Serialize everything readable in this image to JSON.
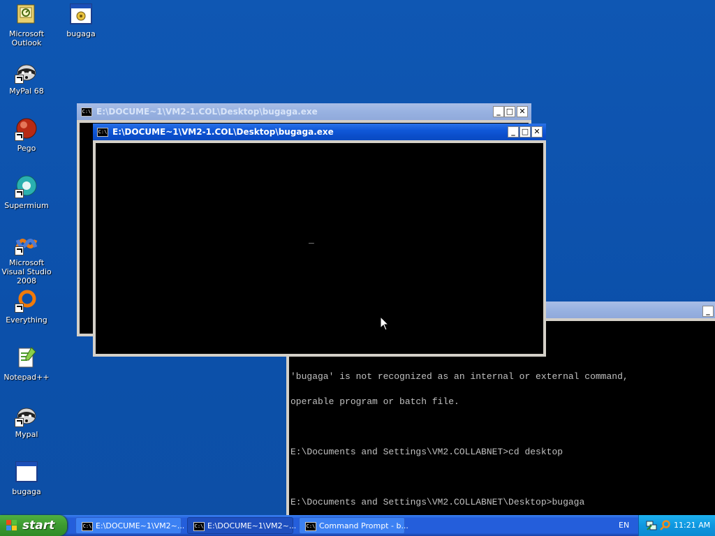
{
  "desktop": {
    "icons": [
      {
        "label": "Microsoft Outlook",
        "icon": "outlook-icon"
      },
      {
        "label": "bugaga",
        "icon": "app-window-icon"
      },
      {
        "label": "MyPal 68",
        "icon": "mypal-raccoon-icon"
      },
      {
        "label": "Pego",
        "icon": "pego-orb-icon"
      },
      {
        "label": "Supermium",
        "icon": "supermium-icon"
      },
      {
        "label": "Microsoft Visual Studio 2008",
        "icon": "visual-studio-icon"
      },
      {
        "label": "Everything",
        "icon": "everything-search-icon"
      },
      {
        "label": "Notepad++",
        "icon": "notepadpp-icon"
      },
      {
        "label": "Mypal",
        "icon": "mypal-raccoon-icon"
      },
      {
        "label": "bugaga",
        "icon": "app-window-icon"
      }
    ]
  },
  "windows": {
    "back": {
      "title": "E:\\DOCUME~1\\VM2-1.COL\\Desktop\\bugaga.exe",
      "icon_text": "C:\\"
    },
    "front": {
      "title": "E:\\DOCUME~1\\VM2-1.COL\\Desktop\\bugaga.exe",
      "icon_text": "C:\\",
      "cursor": "_"
    },
    "cmd": {
      "lines": [
        "'bugaga' is not recognized as an internal or external command,",
        "operable program or batch file.",
        "",
        "E:\\Documents and Settings\\VM2.COLLABNET>cd desktop",
        "",
        "E:\\Documents and Settings\\VM2.COLLABNET\\Desktop>bugaga"
      ]
    },
    "buttons": {
      "minimize": "_",
      "maximize": "□",
      "close": "✕"
    }
  },
  "taskbar": {
    "start_label": "start",
    "buttons": [
      {
        "label": "E:\\DOCUME~1\\VM2~...",
        "state": "normal"
      },
      {
        "label": "E:\\DOCUME~1\\VM2~...",
        "state": "pressed"
      },
      {
        "label": "Command Prompt - b...",
        "state": "normal"
      }
    ],
    "language": "EN",
    "clock": "11:21 AM"
  },
  "colors": {
    "desktop": "#0c50aa",
    "title_active": "#0a4cc8",
    "title_inactive": "#98b2e1",
    "console_bg": "#000000",
    "console_fg": "#c0c0c0"
  }
}
